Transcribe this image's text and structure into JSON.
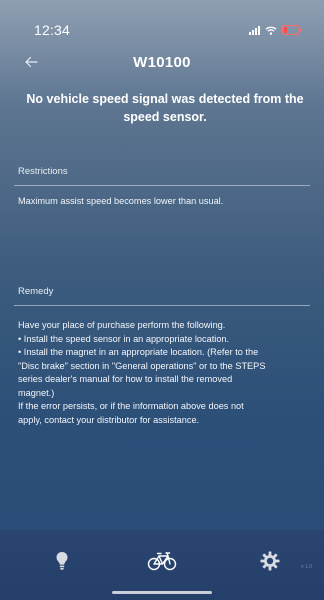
{
  "status_bar": {
    "time": "12:34"
  },
  "nav": {
    "title": "W10100",
    "back_icon": "back-arrow-icon"
  },
  "error": {
    "heading": "No vehicle speed signal was detected from the speed sensor."
  },
  "restrictions": {
    "label": "Restrictions",
    "text": "Maximum assist speed becomes lower than usual."
  },
  "remedy": {
    "label": "Remedy",
    "lines": [
      "Have your place of purchase perform the following.",
      "• Install the speed sensor in an appropriate location.",
      "• Install the magnet in an appropriate location. (Refer to the",
      "\"Disc brake\" section in \"General operations\" or to the STEPS",
      "series dealer's manual for how to install the removed",
      "magnet.)",
      "If the error persists, or if the information above does not",
      "apply, contact your distributor for assistance."
    ]
  },
  "tab_bar": {
    "tabs": [
      {
        "icon": "lightbulb-icon"
      },
      {
        "icon": "bicycle-icon",
        "active": true
      },
      {
        "icon": "gear-icon"
      }
    ],
    "hint": "v 1.0"
  },
  "colors": {
    "background_top": "#8f9fb3",
    "background_bottom": "#2a4a74",
    "tab_bar": "#24406a",
    "battery_low": "#ff4b4b"
  }
}
